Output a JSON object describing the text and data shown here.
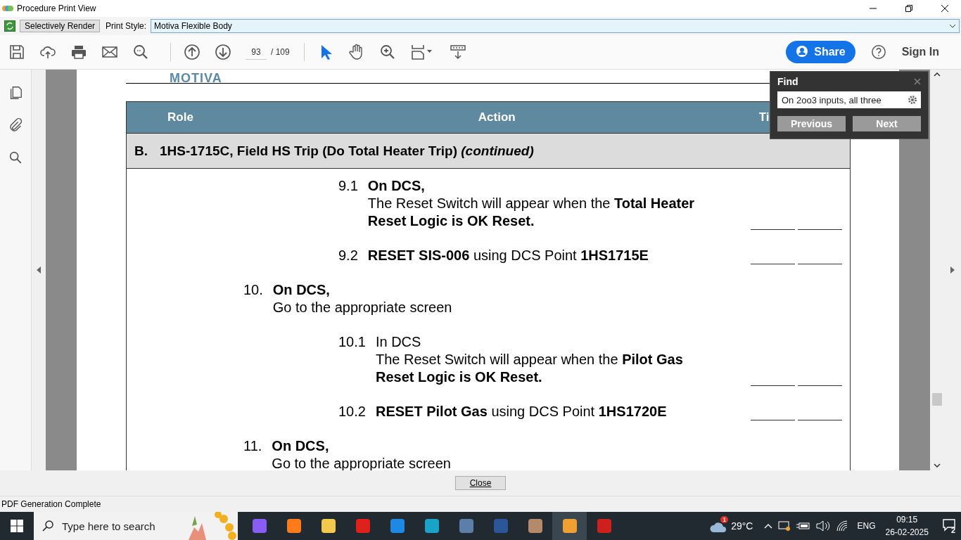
{
  "window": {
    "title": "Procedure Print View"
  },
  "style_bar": {
    "render_button": "Selectively Render",
    "label": "Print Style:",
    "value": "Motiva Flexible Body"
  },
  "toolbar": {
    "page": "93",
    "total": "/ 109",
    "share": "Share",
    "sign_in": "Sign In"
  },
  "document": {
    "logo": "MOTIVA",
    "columns": [
      "Role",
      "Action",
      "Ti"
    ],
    "section": {
      "letter": "B.",
      "title": "1HS-1715C, Field HS Trip (Do Total Heater Trip)",
      "suffix": "(continued)"
    },
    "steps": [
      {
        "kind": "substep",
        "number": "9.1",
        "heading": "On DCS,",
        "heading_bold": true,
        "text": "The Reset Switch will appear when the **Total Heater Reset Logic is OK Reset.**",
        "signoff": true
      },
      {
        "kind": "substep",
        "number": "9.2",
        "text": "**RESET SIS-006** using DCS Point **1HS1715E**",
        "signoff": true
      },
      {
        "kind": "step",
        "number": "10.",
        "heading": "On DCS,",
        "heading_bold": true,
        "text": "Go to the appropriate screen",
        "signoff": false,
        "children": [
          {
            "kind": "substep",
            "number": "10.1",
            "heading": "In DCS",
            "heading_bold": false,
            "text": "The Reset Switch will appear when the **Pilot Gas Reset Logic is OK Reset.**",
            "signoff": true
          },
          {
            "kind": "substep",
            "number": "10.2",
            "text": "**RESET Pilot Gas** using DCS Point **1HS1720E**",
            "signoff": true
          }
        ]
      },
      {
        "kind": "step",
        "number": "11.",
        "heading": "On DCS,",
        "heading_bold": true,
        "text": "Go to the appropriate screen",
        "signoff": false
      }
    ]
  },
  "find": {
    "title": "Find",
    "query": "On 2oo3 inputs, all three",
    "previous": "Previous",
    "next": "Next"
  },
  "close_button": "Close",
  "status_bar": "PDF Generation Complete",
  "taskbar": {
    "search_placeholder": "Type here to search",
    "weather_badge": "1",
    "temperature": "29°C",
    "language": "ENG",
    "time": "09:15",
    "date": "26-02-2025",
    "notifications": "2"
  }
}
